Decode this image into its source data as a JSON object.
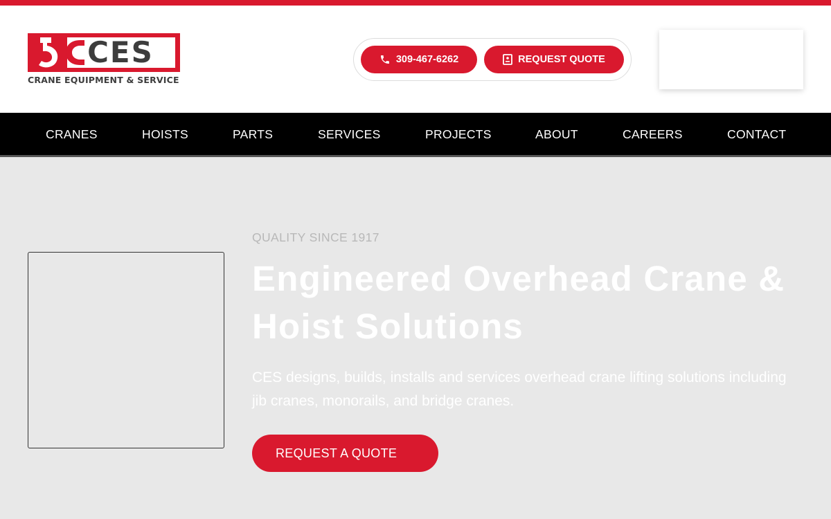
{
  "brand": {
    "logo_text": "CES",
    "tagline": "CRANE EQUIPMENT & SERVICE",
    "accent_color": "#d9192e",
    "dark_color": "#3d3d3d"
  },
  "header": {
    "phone_label": "309-467-6262",
    "phone_icon": "phone-icon",
    "quote_label": "REQUEST QUOTE",
    "quote_icon": "document-icon"
  },
  "nav": {
    "items": [
      {
        "label": "CRANES"
      },
      {
        "label": "HOISTS"
      },
      {
        "label": "PARTS"
      },
      {
        "label": "SERVICES"
      },
      {
        "label": "PROJECTS"
      },
      {
        "label": "ABOUT"
      },
      {
        "label": "CAREERS"
      },
      {
        "label": "CONTACT"
      }
    ]
  },
  "hero": {
    "eyebrow": "QUALITY SINCE 1917",
    "title": "Engineered Overhead Crane & Hoist Solutions",
    "description": "CES designs, builds, installs and services overhead crane lifting solutions including jib cranes, monorails, and bridge cranes.",
    "cta_label": "REQUEST A QUOTE"
  }
}
